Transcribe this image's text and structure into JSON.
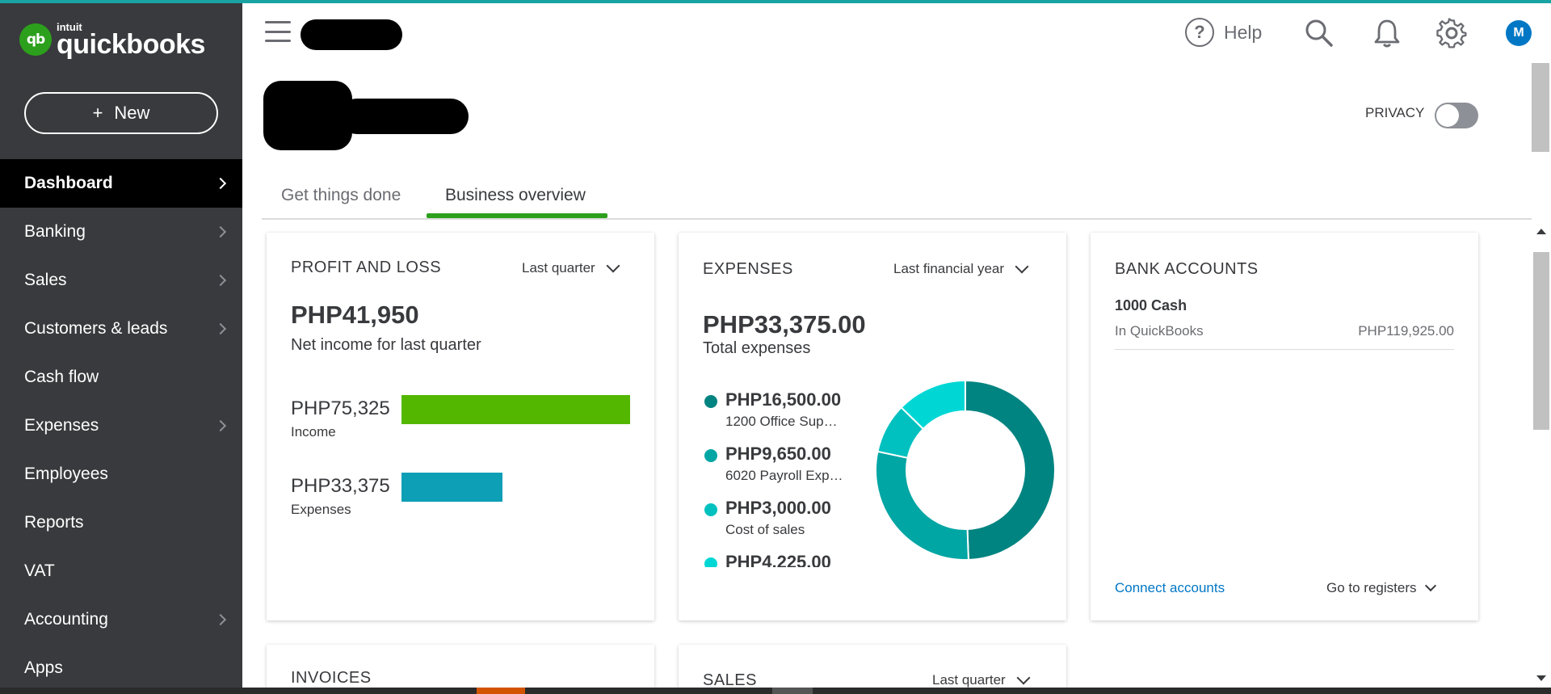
{
  "app": {
    "brand_small": "intuit",
    "brand_name": "quickbooks",
    "logo_mark": "qb"
  },
  "sidebar": {
    "new_button": "New",
    "items": [
      {
        "label": "Dashboard",
        "chevron": true,
        "active": true
      },
      {
        "label": "Banking",
        "chevron": true
      },
      {
        "label": "Sales",
        "chevron": true
      },
      {
        "label": "Customers & leads",
        "chevron": true
      },
      {
        "label": "Cash flow",
        "chevron": false
      },
      {
        "label": "Expenses",
        "chevron": true
      },
      {
        "label": "Employees",
        "chevron": false
      },
      {
        "label": "Reports",
        "chevron": false
      },
      {
        "label": "VAT",
        "chevron": false
      },
      {
        "label": "Accounting",
        "chevron": true
      },
      {
        "label": "Apps",
        "chevron": false
      }
    ]
  },
  "header": {
    "help_label": "Help",
    "help_glyph": "?",
    "avatar_initial": "M",
    "privacy_label": "PRIVACY",
    "privacy_on": false
  },
  "tabs": [
    {
      "label": "Get things done",
      "active": false
    },
    {
      "label": "Business overview",
      "active": true
    }
  ],
  "profit_loss": {
    "title": "PROFIT AND LOSS",
    "period": "Last quarter",
    "net_income": "PHP41,950",
    "net_income_label": "Net income for last quarter",
    "income_amount": "PHP75,325",
    "income_label": "Income",
    "expenses_amount": "PHP33,375",
    "expenses_label": "Expenses",
    "income_value": 75325,
    "expenses_value": 33375,
    "income_color": "#53b700",
    "expenses_color": "#0d9fb5"
  },
  "expenses": {
    "title": "EXPENSES",
    "period": "Last financial year",
    "total": "PHP33,375.00",
    "total_label": "Total expenses",
    "items": [
      {
        "amount": "PHP16,500.00",
        "label": "1200 Office Sup…",
        "value": 16500,
        "color": "#008481"
      },
      {
        "amount": "PHP9,650.00",
        "label": "6020 Payroll Exp…",
        "value": 9650,
        "color": "#00a6a4"
      },
      {
        "amount": "PHP3,000.00",
        "label": "Cost of sales",
        "value": 3000,
        "color": "#00c1bf"
      },
      {
        "amount": "PHP4,225.00",
        "label": "",
        "value": 4225,
        "color": "#00d7d5"
      }
    ]
  },
  "bank_accounts": {
    "title": "BANK ACCOUNTS",
    "account_name": "1000 Cash",
    "account_source": "In QuickBooks",
    "account_balance": "PHP119,925.00",
    "connect_link": "Connect accounts",
    "registers_link": "Go to registers"
  },
  "invoices": {
    "title": "INVOICES"
  },
  "sales": {
    "title": "SALES",
    "period": "Last quarter"
  }
}
